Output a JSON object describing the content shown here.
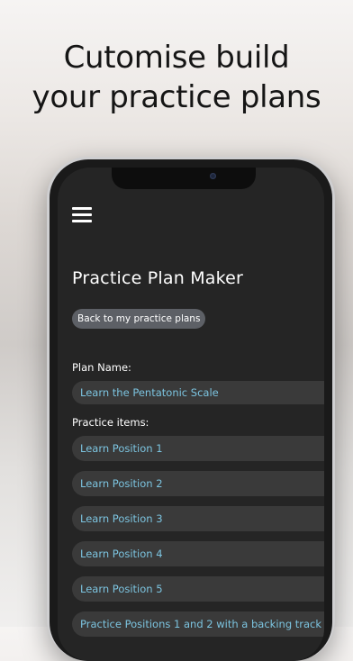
{
  "headline": {
    "line1": "Cutomise build",
    "line2": "your practice plans"
  },
  "icons": {
    "menu": "hamburger-menu-icon"
  },
  "screen": {
    "title": "Practice Plan Maker",
    "back_button": "Back to my practice plans",
    "plan_name_label": "Plan Name:",
    "plan_name_value": "Learn the Pentatonic Scale",
    "practice_items_label": "Practice items:",
    "items": [
      "Learn Position 1",
      "Learn Position 2",
      "Learn Position 3",
      "Learn Position 4",
      "Learn Position 5",
      "Practice Positions 1 and 2 with a backing track"
    ]
  },
  "colors": {
    "screen_bg": "#252525",
    "field_bg": "#3a3a3a",
    "item_text": "#7cc4e0",
    "button_bg": "#5d6066"
  }
}
